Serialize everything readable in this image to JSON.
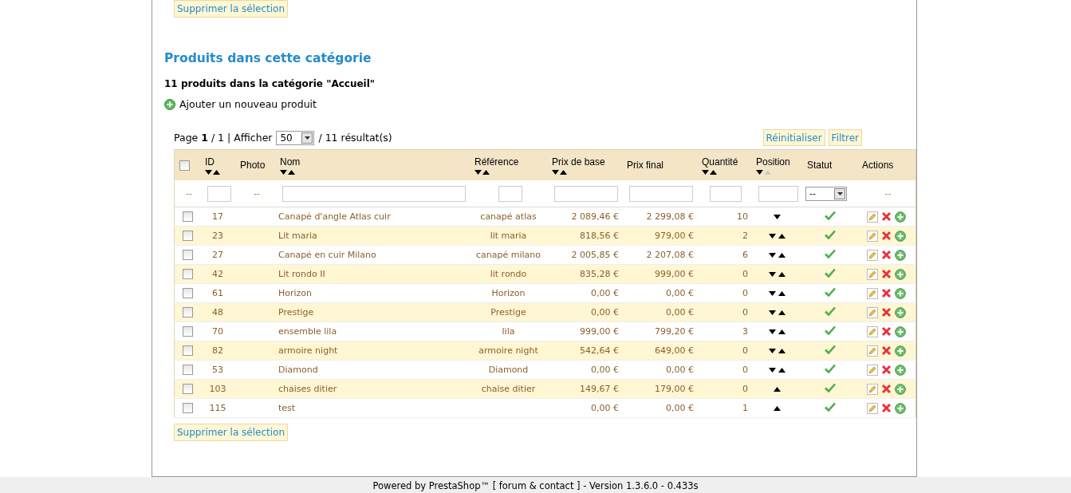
{
  "top_button": "Supprimer la sélection",
  "section_title": "Produits dans cette catégorie",
  "summary": "11 produits dans la catégorie \"Accueil\"",
  "add_link": "Ajouter un nouveau produit",
  "pagination": {
    "page_label": "Page",
    "page": "1",
    "separator": "/ 1 | Afficher",
    "per_page": "50",
    "results": "/ 11 résultat(s)"
  },
  "filter_buttons": [
    "Réinitialiser",
    "Filtrer"
  ],
  "select_all_checked": false,
  "columns": [
    {
      "kind": "check"
    },
    {
      "kind": "id",
      "label": "ID",
      "sortable": true,
      "sorted_ascending": false
    },
    {
      "kind": "photo",
      "label": "Photo",
      "sortable": false
    },
    {
      "kind": "name",
      "label": "Nom",
      "sortable": true,
      "sorted_ascending": false
    },
    {
      "kind": "ref",
      "label": "Référence",
      "sortable": true,
      "sorted_ascending": false
    },
    {
      "kind": "base",
      "label": "Prix de base",
      "sortable": true,
      "sorted_ascending": false
    },
    {
      "kind": "final",
      "label": "Prix final",
      "sortable": false
    },
    {
      "kind": "qty",
      "label": "Quantité",
      "sortable": true,
      "sorted_ascending": false
    },
    {
      "kind": "pos",
      "label": "Position",
      "sortable": true,
      "sorted_ascending": true
    },
    {
      "kind": "status",
      "label": "Statut",
      "sortable": false
    },
    {
      "kind": "actions",
      "label": "Actions",
      "sortable": false
    }
  ],
  "filters": [
    {
      "kind": "dash",
      "text": "--"
    },
    {
      "kind": "input"
    },
    {
      "kind": "dash",
      "text": "--"
    },
    {
      "kind": "input"
    },
    {
      "kind": "input"
    },
    {
      "kind": "input"
    },
    {
      "kind": "input"
    },
    {
      "kind": "input"
    },
    {
      "kind": "input"
    },
    {
      "kind": "select",
      "text": "--"
    },
    {
      "kind": "dash",
      "text": "--"
    }
  ],
  "rows": [
    {
      "selected": false,
      "id": "17",
      "name": "Canapé d'angle Atlas cuir",
      "reference": "canapé atlas",
      "base_price": "2 089,46 €",
      "final_price": "2 299,08 €",
      "quantity": "10",
      "move_down": true,
      "move_up": false,
      "active": true
    },
    {
      "selected": false,
      "id": "23",
      "name": "Lit maria",
      "reference": "lit maria",
      "base_price": "818,56 €",
      "final_price": "979,00 €",
      "quantity": "2",
      "move_down": true,
      "move_up": true,
      "active": true
    },
    {
      "selected": false,
      "id": "27",
      "name": "Canapé en cuir Milano",
      "reference": "canapé milano",
      "base_price": "2 005,85 €",
      "final_price": "2 207,08 €",
      "quantity": "6",
      "move_down": true,
      "move_up": true,
      "active": true
    },
    {
      "selected": false,
      "id": "42",
      "name": "Lit rondo II",
      "reference": "lit rondo",
      "base_price": "835,28 €",
      "final_price": "999,00 €",
      "quantity": "0",
      "move_down": true,
      "move_up": true,
      "active": true
    },
    {
      "selected": false,
      "id": "61",
      "name": "Horizon",
      "reference": "Horizon",
      "base_price": "0,00 €",
      "final_price": "0,00 €",
      "quantity": "0",
      "move_down": true,
      "move_up": true,
      "active": true
    },
    {
      "selected": false,
      "id": "48",
      "name": "Prestige",
      "reference": "Prestige",
      "base_price": "0,00 €",
      "final_price": "0,00 €",
      "quantity": "0",
      "move_down": true,
      "move_up": true,
      "active": true
    },
    {
      "selected": false,
      "id": "70",
      "name": "ensemble lila",
      "reference": "lila",
      "base_price": "999,00 €",
      "final_price": "799,20 €",
      "quantity": "3",
      "move_down": true,
      "move_up": true,
      "active": true
    },
    {
      "selected": false,
      "id": "82",
      "name": "armoire night",
      "reference": "armoire night",
      "base_price": "542,64 €",
      "final_price": "649,00 €",
      "quantity": "0",
      "move_down": true,
      "move_up": true,
      "active": true
    },
    {
      "selected": false,
      "id": "53",
      "name": "Diamond",
      "reference": "Diamond",
      "base_price": "0,00 €",
      "final_price": "0,00 €",
      "quantity": "0",
      "move_down": true,
      "move_up": true,
      "active": true
    },
    {
      "selected": false,
      "id": "103",
      "name": "chaises ditier",
      "reference": "chaise ditier",
      "base_price": "149,67 €",
      "final_price": "179,00 €",
      "quantity": "0",
      "move_down": false,
      "move_up": true,
      "active": true
    },
    {
      "selected": false,
      "id": "115",
      "name": "test",
      "base_price": "0,00 €",
      "final_price": "0,00 €",
      "quantity": "1",
      "move_down": false,
      "move_up": true,
      "active": true
    }
  ],
  "bottom_button": "Supprimer la sélection",
  "footer": "Powered by PrestaShop™ [ forum & contact ] - Version 1.3.6.0 - 0.433s"
}
